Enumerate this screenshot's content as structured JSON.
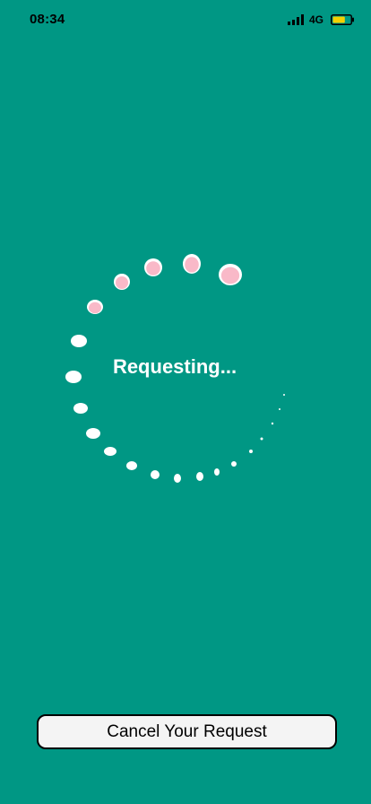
{
  "status_bar": {
    "time": "08:34",
    "network": "4G",
    "signal_icon": "cellular-signal-icon",
    "battery_icon": "battery-icon",
    "battery_level": 0.7,
    "battery_color": "#f5d000"
  },
  "loading": {
    "label": "Requesting...",
    "dot_color": "#ffffff",
    "highlight_color": "#f9b9c8"
  },
  "actions": {
    "cancel_label": "Cancel Your Request"
  }
}
